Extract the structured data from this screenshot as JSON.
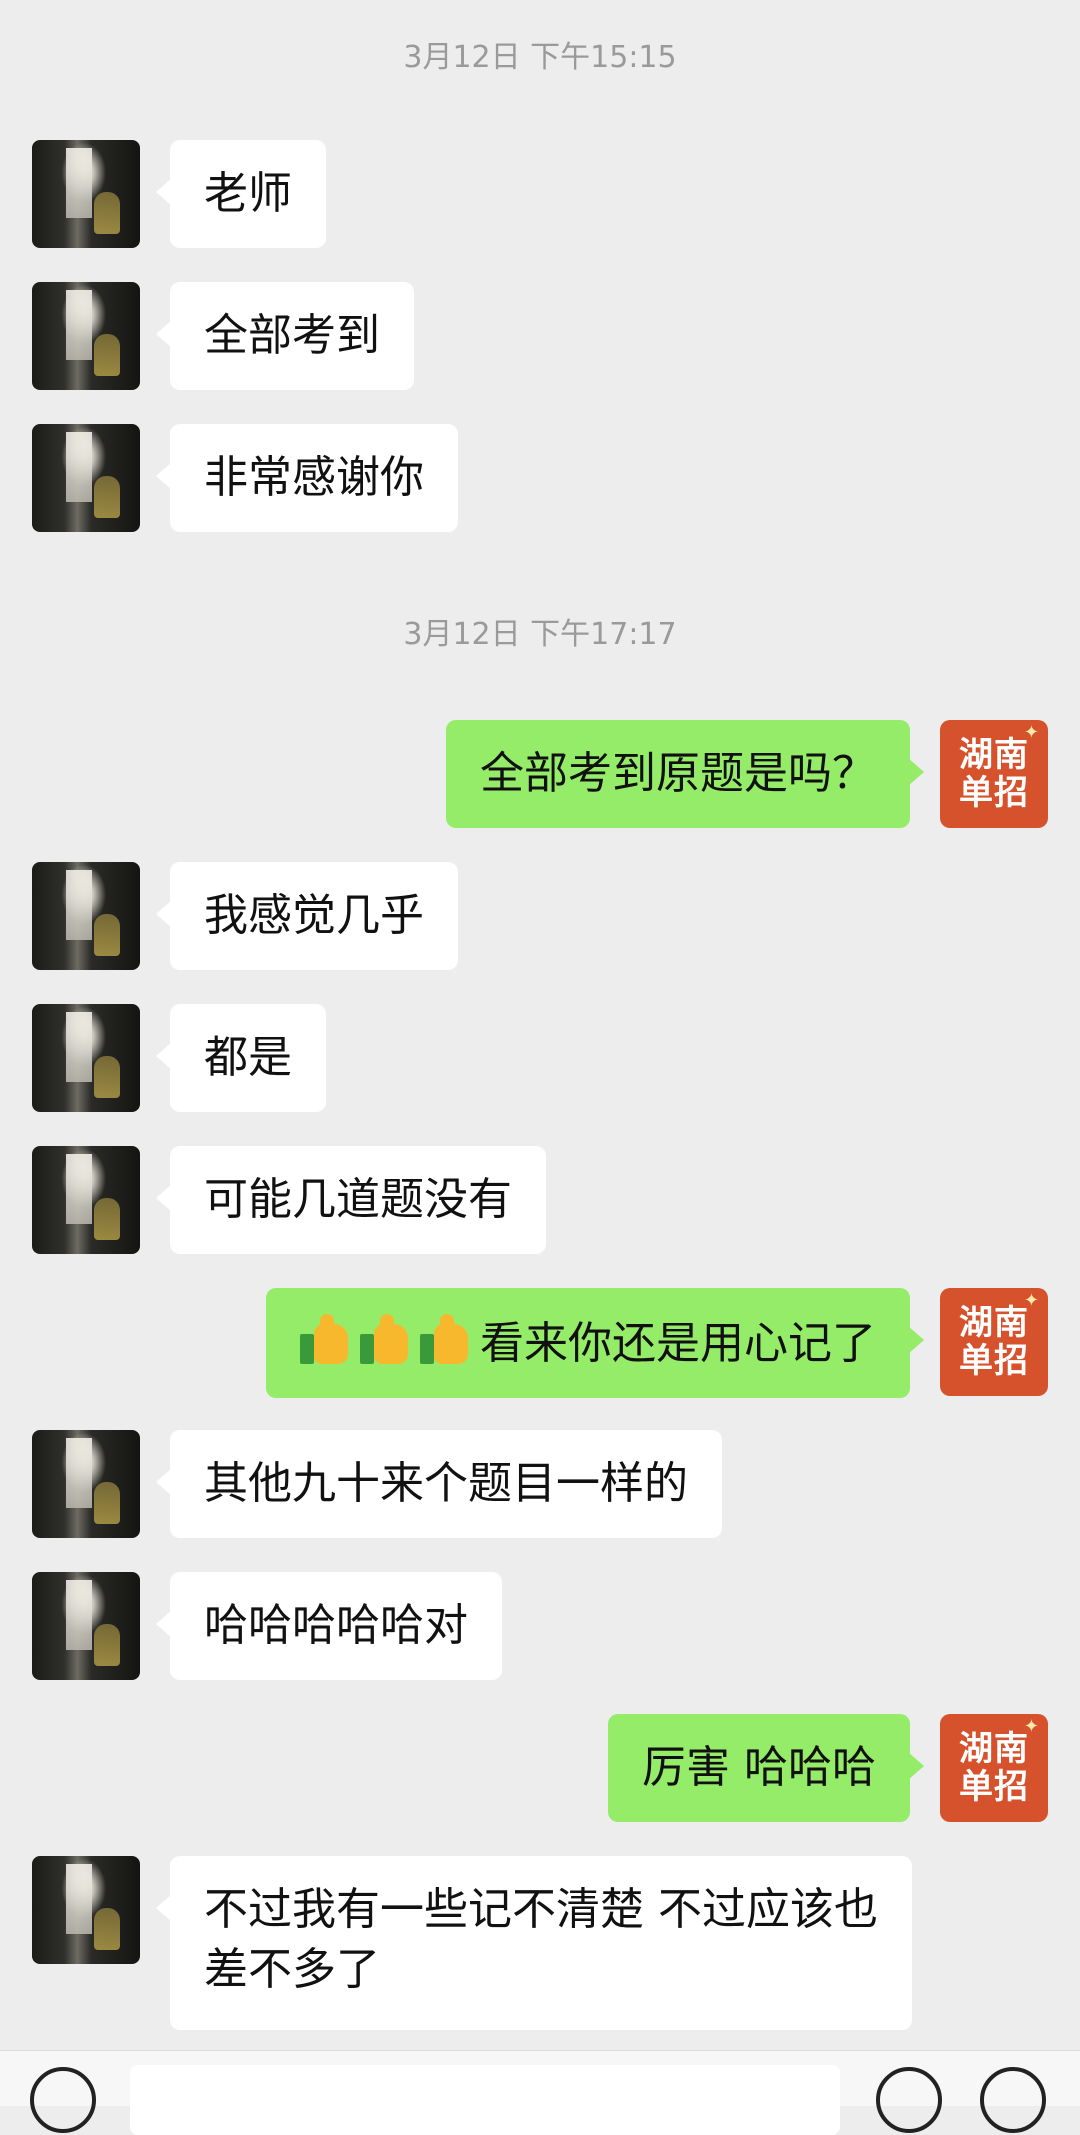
{
  "timestamps": [
    "3月12日 下午15:15",
    "3月12日 下午17:17"
  ],
  "peer_avatar": "peer-avatar-photo",
  "self_avatar": {
    "line1": "湖南",
    "line2": "单招",
    "spark": "✦"
  },
  "messages": [
    {
      "from": "peer",
      "text": "老师"
    },
    {
      "from": "peer",
      "text": "全部考到"
    },
    {
      "from": "peer",
      "text": "非常感谢你"
    },
    {
      "from": "self",
      "text": "全部考到原题是吗？"
    },
    {
      "from": "peer",
      "text": "我感觉几乎"
    },
    {
      "from": "peer",
      "text": "都是"
    },
    {
      "from": "peer",
      "text": "可能几道题没有"
    },
    {
      "from": "self",
      "emoji": [
        "thumbs-up",
        "thumbs-up",
        "thumbs-up"
      ],
      "text": "看来你还是用心记了"
    },
    {
      "from": "peer",
      "text": "其他九十来个题目一样的"
    },
    {
      "from": "peer",
      "text": "哈哈哈哈哈对"
    },
    {
      "from": "self",
      "text": "厉害 哈哈哈"
    },
    {
      "from": "peer",
      "text": "不过我有一些记不清楚 不过应该也差不多了"
    }
  ],
  "colors": {
    "background": "#ededed",
    "self_bubble": "#95ec69",
    "peer_bubble": "#ffffff",
    "self_avatar": "#d5522d"
  }
}
